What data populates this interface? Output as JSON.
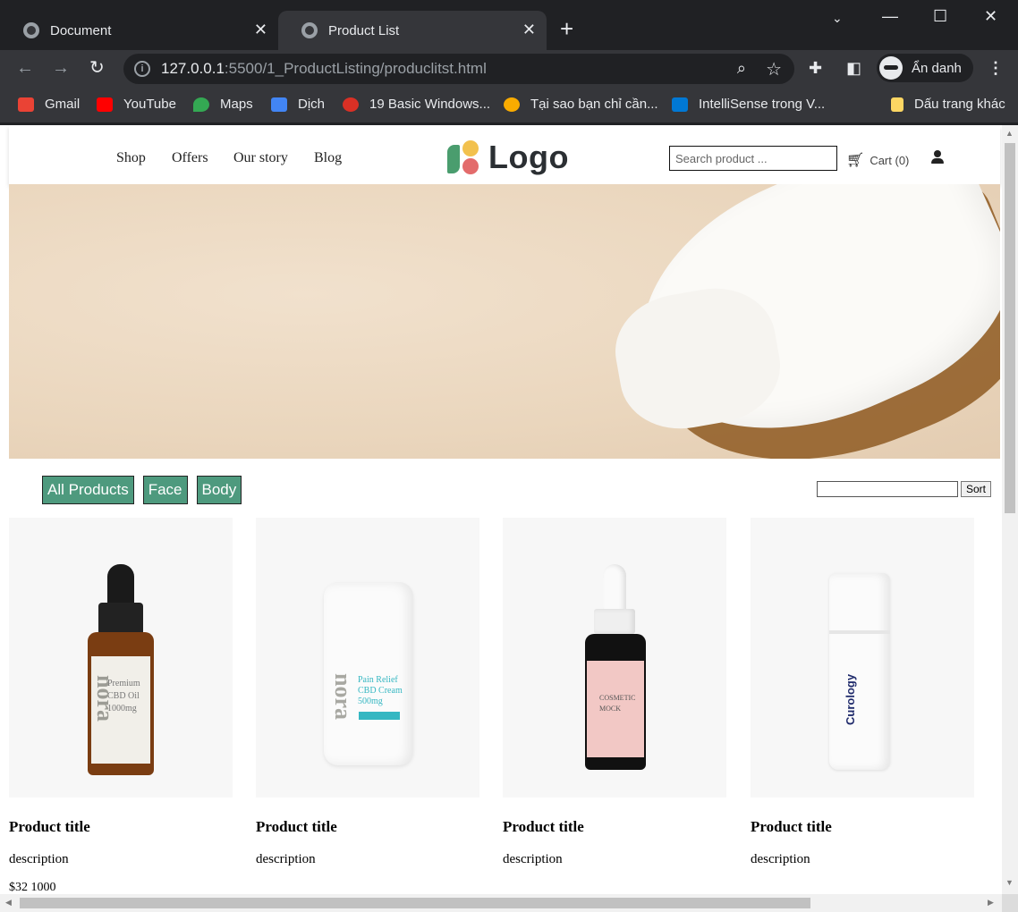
{
  "browser": {
    "tabs": [
      {
        "title": "Document"
      },
      {
        "title": "Product List"
      }
    ],
    "url_host": "127.0.0.1",
    "url_path": ":5500/1_ProductListing/produclitst.html",
    "incognito_label": "Ẩn danh",
    "bookmarks": [
      {
        "label": "Gmail",
        "color": "#ea4335"
      },
      {
        "label": "YouTube",
        "color": "#ff0000"
      },
      {
        "label": "Maps",
        "color": "#34a853"
      },
      {
        "label": "Dịch",
        "color": "#4285f4"
      },
      {
        "label": "19 Basic Windows...",
        "color": "#d93025"
      },
      {
        "label": "Tại sao bạn chỉ cần...",
        "color": "#f9ab00"
      },
      {
        "label": "IntelliSense trong V...",
        "color": "#0078d4"
      },
      {
        "label": "Dấu trang khác",
        "color": "#fdd663"
      }
    ]
  },
  "site": {
    "nav": [
      "Shop",
      "Offers",
      "Our story",
      "Blog"
    ],
    "logo_text": "Logo",
    "search_placeholder": "Search product ...",
    "cart_label": "Cart (0)",
    "filters": [
      "All Products",
      "Face",
      "Body"
    ],
    "sort_label": "Sort",
    "accent_color": "#4e9a7e",
    "products": [
      {
        "title": "Product title",
        "description": "description",
        "price": "$32 1000",
        "label_lines": [
          "Premium",
          "CBD Oil",
          "1000mg"
        ],
        "brand": "nora"
      },
      {
        "title": "Product title",
        "description": "description",
        "price": "",
        "label_lines": [
          "Pain Relief",
          "CBD Cream",
          "500mg"
        ],
        "brand": "nora"
      },
      {
        "title": "Product title",
        "description": "description",
        "price": "",
        "label_lines": [
          "COSMETIC",
          "MOCK"
        ],
        "brand": ""
      },
      {
        "title": "Product title",
        "description": "description",
        "price": "",
        "label_lines": [
          "Curology"
        ],
        "brand": "Curology"
      }
    ]
  }
}
